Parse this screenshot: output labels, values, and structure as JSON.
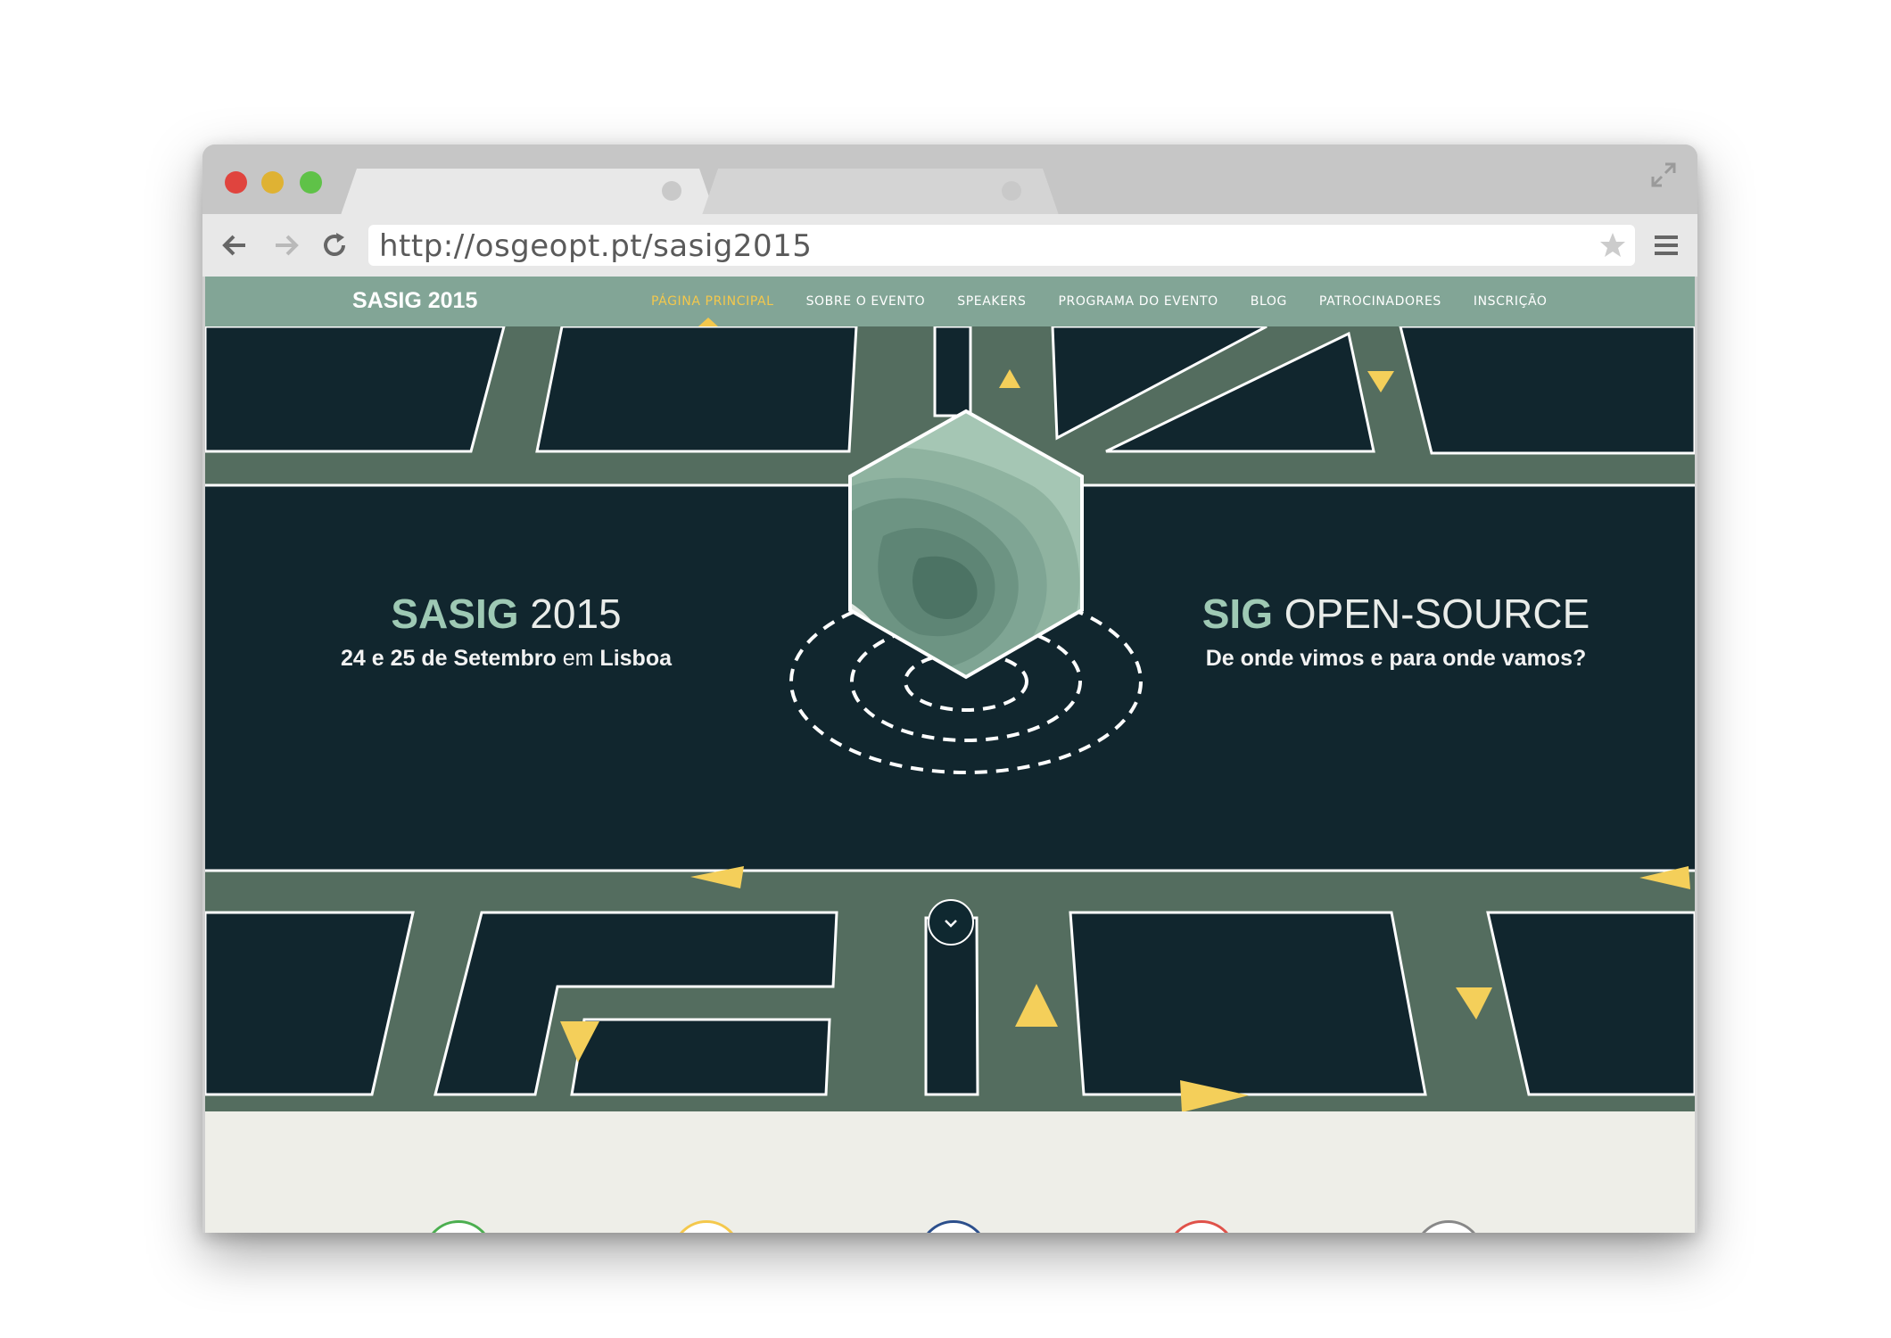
{
  "browser": {
    "url": "http://osgeopt.pt/sasig2015"
  },
  "site": {
    "brand": "SASIG 2015",
    "nav": [
      {
        "label": "PÁGINA PRINCIPAL",
        "active": true
      },
      {
        "label": "SOBRE O EVENTO",
        "active": false
      },
      {
        "label": "SPEAKERS",
        "active": false
      },
      {
        "label": "PROGRAMA DO EVENTO",
        "active": false
      },
      {
        "label": "BLOG",
        "active": false
      },
      {
        "label": "PATROCINADORES",
        "active": false
      },
      {
        "label": "INSCRIÇÃO",
        "active": false
      }
    ]
  },
  "hero": {
    "left": {
      "title_strong": "SASIG",
      "title_light": "2015",
      "sub_a": "24 e 25 de Setembro",
      "sub_b": "em",
      "sub_c": "Lisboa"
    },
    "right": {
      "title_strong": "SIG",
      "title_light": "OPEN-SOURCE",
      "subtitle": "De onde vimos e para onde vamos?"
    }
  },
  "features": [
    {
      "icon": "question-icon",
      "glyph": "?",
      "color": "#4caf50"
    },
    {
      "icon": "person-pin-icon",
      "glyph": "●",
      "color": "#f4c84c"
    },
    {
      "icon": "book-icon",
      "glyph": "▮▮",
      "color": "#2c4f8c"
    },
    {
      "icon": "group-icon",
      "glyph": "●●●",
      "color": "#e0524a"
    },
    {
      "icon": "support-icon",
      "glyph": "◍",
      "color": "#888888"
    }
  ],
  "colors": {
    "nav_bg": "#82a596",
    "nav_active": "#f4c84c",
    "road": "#546d5f",
    "block": "#11262e",
    "arrow": "#f4cf5a",
    "title_accent": "#9ec9b4"
  }
}
